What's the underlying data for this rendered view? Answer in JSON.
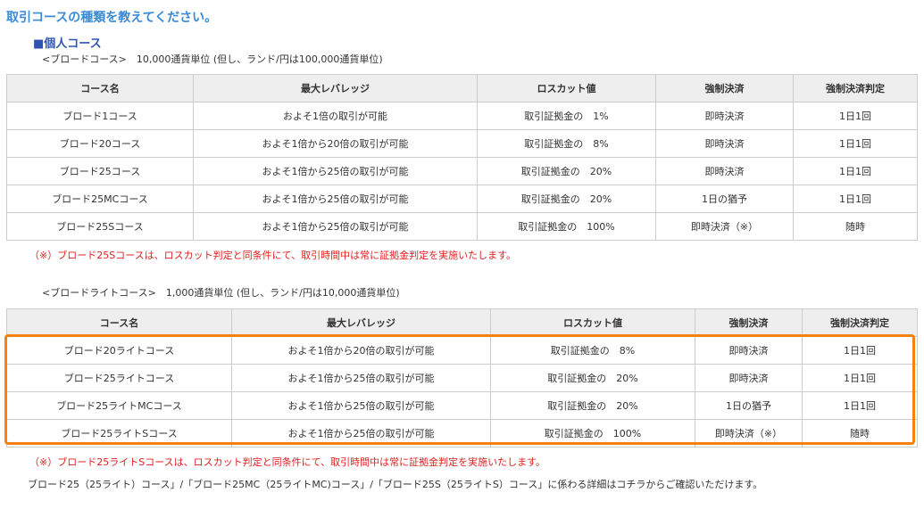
{
  "page": {
    "title": "取引コースの種類を教えてください。",
    "subheading": "■個人コース"
  },
  "broad": {
    "note": "<ブロードコース>　10,000通貨単位 (但し、ランド/円は100,000通貨単位)",
    "columns": [
      "コース名",
      "最大レバレッジ",
      "ロスカット値",
      "強制決済",
      "強制決済判定"
    ],
    "rows": [
      [
        "ブロード1コース",
        "およそ1倍の取引が可能",
        "取引証拠金の　1%",
        "即時決済",
        "1日1回"
      ],
      [
        "ブロード20コース",
        "およそ1倍から20倍の取引が可能",
        "取引証拠金の　8%",
        "即時決済",
        "1日1回"
      ],
      [
        "ブロード25コース",
        "およそ1倍から25倍の取引が可能",
        "取引証拠金の　20%",
        "即時決済",
        "1日1回"
      ],
      [
        "ブロード25MCコース",
        "およそ1倍から25倍の取引が可能",
        "取引証拠金の　20%",
        "1日の猶予",
        "1日1回"
      ],
      [
        "ブロード25Sコース",
        "およそ1倍から25倍の取引が可能",
        "取引証拠金の　100%",
        "即時決済（※）",
        "随時"
      ]
    ],
    "footnote": "（※）ブロード25Sコースは、ロスカット判定と同条件にて、取引時間中は常に証拠金判定を実施いたします。"
  },
  "broad_lite": {
    "note": "<ブロードライトコース>　1,000通貨単位 (但し、ランド/円は10,000通貨単位)",
    "columns": [
      "コース名",
      "最大レバレッジ",
      "ロスカット値",
      "強制決済",
      "強制決済判定"
    ],
    "rows": [
      [
        "ブロード20ライトコース",
        "およそ1倍から20倍の取引が可能",
        "取引証拠金の　8%",
        "即時決済",
        "1日1回"
      ],
      [
        "ブロード25ライトコース",
        "およそ1倍から25倍の取引が可能",
        "取引証拠金の　20%",
        "即時決済",
        "1日1回"
      ],
      [
        "ブロード25ライトMCコース",
        "およそ1倍から25倍の取引が可能",
        "取引証拠金の　20%",
        "1日の猶予",
        "1日1回"
      ],
      [
        "ブロード25ライトSコース",
        "およそ1倍から25倍の取引が可能",
        "取引証拠金の　100%",
        "即時決済（※）",
        "随時"
      ]
    ],
    "footnote": "（※）ブロード25ライトSコースは、ロスカット判定と同条件にて、取引時間中は常に証拠金判定を実施いたします。"
  },
  "links_text": "ブロード25（25ライト）コース」/「ブロード25MC（25ライトMC)コース」/「ブロード25S（25ライトS）コース」に係わる詳細はコチラからご確認いただけます。",
  "colors": {
    "title": "#3a8ad6",
    "subheading": "#2d55b0",
    "footnote": "#e02020",
    "highlight_border": "#f5820d",
    "header_bg": "#eeeeee"
  }
}
